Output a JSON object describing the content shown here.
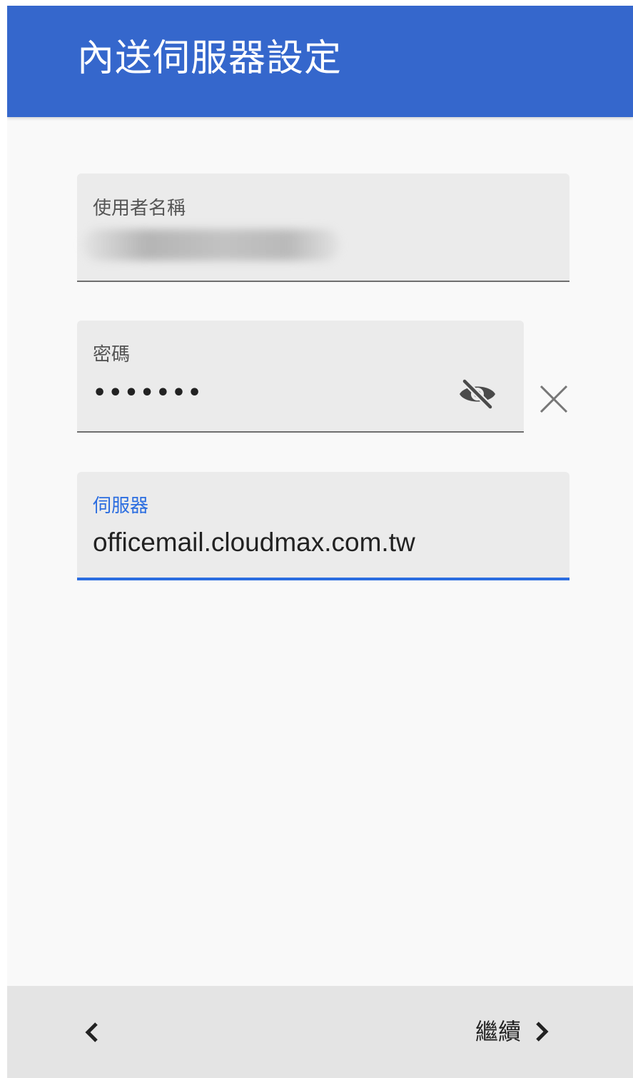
{
  "app_bar": {
    "title": "內送伺服器設定"
  },
  "form": {
    "username": {
      "label": "使用者名稱",
      "value_redacted": true
    },
    "password": {
      "label": "密碼",
      "value": "•••••••",
      "visibility_icon": "eye-off-icon",
      "clear_icon": "close-icon"
    },
    "server": {
      "label": "伺服器",
      "value": "officemail.cloudmax.com.tw"
    }
  },
  "bottom_bar": {
    "back_icon": "chevron-left-icon",
    "continue_label": "繼續",
    "continue_icon": "chevron-right-icon"
  },
  "colors": {
    "app_bar": "#3567cc",
    "accent": "#2b6de0",
    "field_background": "#ebebeb",
    "page_background": "#f9f9f9",
    "bottom_bar": "#e4e4e4"
  }
}
